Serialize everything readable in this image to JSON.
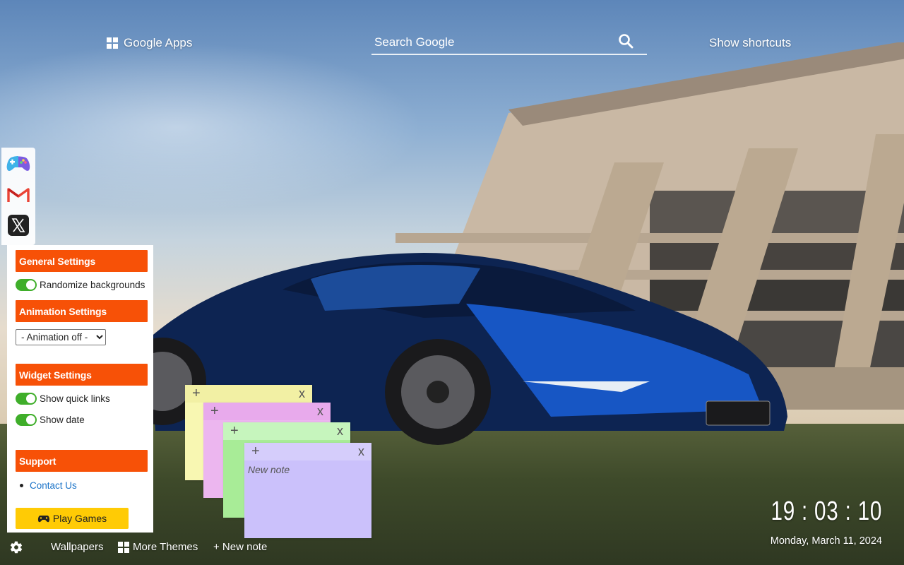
{
  "header": {
    "apps_label": "Google Apps",
    "search_placeholder": "Search Google",
    "shortcuts_label": "Show shortcuts"
  },
  "quick_links": [
    {
      "name": "games",
      "icon": "gamepad-icon"
    },
    {
      "name": "gmail",
      "icon": "gmail-icon"
    },
    {
      "name": "x",
      "icon": "x-twitter-icon"
    }
  ],
  "settings": {
    "general_heading": "General Settings",
    "randomize_label": "Randomize backgrounds",
    "animation_heading": "Animation Settings",
    "animation_value": "- Animation off -",
    "widget_heading": "Widget Settings",
    "quick_links_label": "Show quick links",
    "show_date_label": "Show date",
    "support_heading": "Support",
    "contact_label": "Contact Us",
    "play_label": "Play Games"
  },
  "bottom": {
    "wallpapers": "Wallpapers",
    "more_themes": "More Themes",
    "new_note": "+ New note"
  },
  "notes": [
    {
      "color": "#f8f7b2",
      "bar": "#f2f0a4",
      "text": ""
    },
    {
      "color": "#ecb6ef",
      "bar": "#e8aaec",
      "text": ""
    },
    {
      "color": "#a8ec97",
      "bar": "#c6f5bd",
      "text": ""
    },
    {
      "color": "#cbc1fb",
      "bar": "#d5cdfb",
      "text": "New note"
    }
  ],
  "note_plus": "+",
  "note_close": "x",
  "clock": {
    "time": "19 : 03 : 10",
    "date": "Monday, March 11, 2024"
  },
  "colors": {
    "section_header": "#f75107",
    "toggle_on": "#3fae2a",
    "play_button": "#ffcb05"
  }
}
